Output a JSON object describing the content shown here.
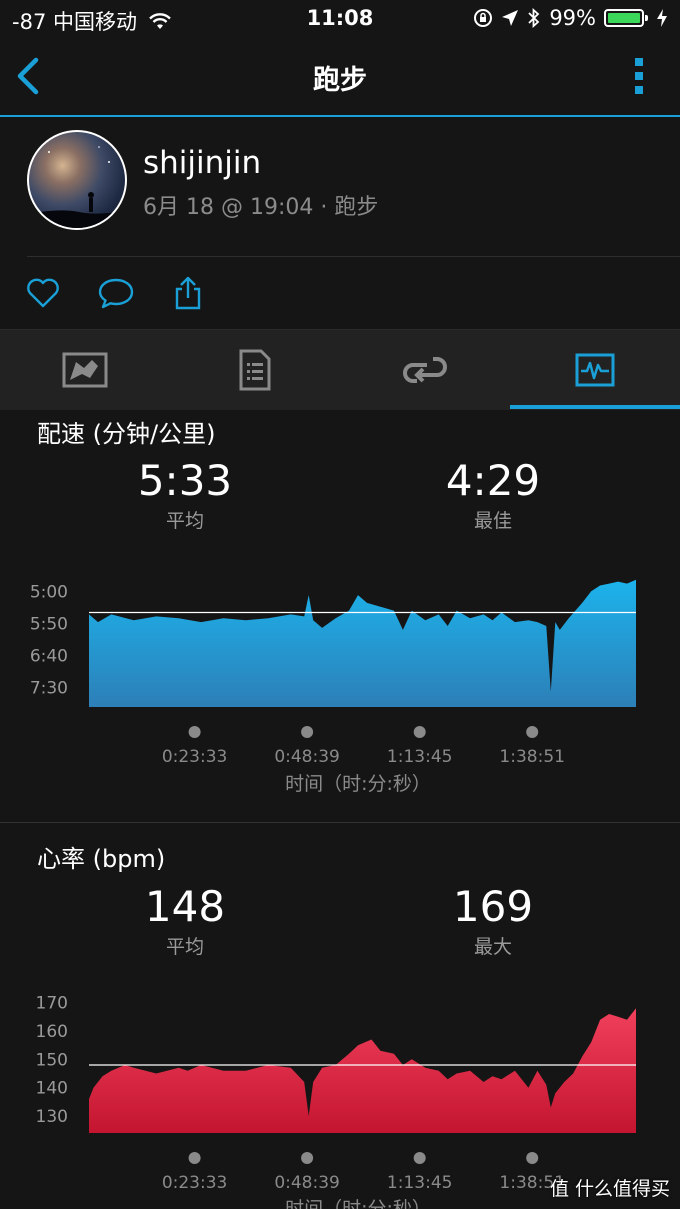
{
  "status": {
    "signal": "-87",
    "carrier": "中国移动",
    "time": "11:08",
    "battery": "99%",
    "icons": [
      "wifi-icon",
      "rotation-lock-icon",
      "location-icon",
      "bluetooth-icon",
      "battery-icon",
      "charging-icon"
    ]
  },
  "nav": {
    "title": "跑步",
    "back_icon": "chevron-left-icon",
    "more_icon": "more-vertical-icon"
  },
  "profile": {
    "username": "shijinjin",
    "meta": "6月 18 @ 19:04 · 跑步"
  },
  "actions": [
    "heart-icon",
    "comment-icon",
    "share-icon"
  ],
  "tabs": [
    {
      "name": "map-icon",
      "active": false
    },
    {
      "name": "details-icon",
      "active": false
    },
    {
      "name": "laps-icon",
      "active": false
    },
    {
      "name": "charts-icon",
      "active": true
    }
  ],
  "colors": {
    "accent": "#1aa0d6",
    "pace": "#22a8df",
    "heartrate": "#e0203f"
  },
  "pace": {
    "title": "配速 (分钟/公里)",
    "avg_value": "5:33",
    "avg_label": "平均",
    "best_value": "4:29",
    "best_label": "最佳",
    "xlabel": "时间（时:分:秒）",
    "xticks": [
      "0:23:33",
      "0:48:39",
      "1:13:45",
      "1:38:51"
    ],
    "yticks": [
      "5:00",
      "5:50",
      "6:40",
      "7:30"
    ]
  },
  "hr": {
    "title": "心率 (bpm)",
    "avg_value": "148",
    "avg_label": "平均",
    "max_value": "169",
    "max_label": "最大",
    "xlabel": "时间（时:分:秒）",
    "xticks": [
      "0:23:33",
      "0:48:39",
      "1:13:45",
      "1:38:51"
    ],
    "yticks": [
      "170",
      "160",
      "150",
      "140",
      "130"
    ]
  },
  "watermark": {
    "text": "值 什么值得买"
  },
  "chart_data": [
    {
      "type": "area",
      "title": "配速 (分钟/公里)",
      "xlabel": "时间（时:分:秒）",
      "unit": "min/km",
      "y_reversed": true,
      "xlim": [
        0,
        122
      ],
      "ylim": [
        8.0,
        4.5
      ],
      "avg_line": 5.55,
      "x": [
        0,
        2,
        5,
        10,
        15,
        20,
        25,
        30,
        35,
        40,
        45,
        48,
        49,
        50,
        52,
        55,
        58,
        60,
        62,
        65,
        68,
        70,
        72,
        75,
        78,
        80,
        82,
        85,
        88,
        90,
        92,
        95,
        98,
        100,
        102,
        103,
        104,
        105,
        107,
        110,
        112,
        114,
        116,
        118,
        120,
        122
      ],
      "values": [
        5.6,
        5.8,
        5.6,
        5.75,
        5.65,
        5.7,
        5.8,
        5.7,
        5.75,
        5.7,
        5.6,
        5.65,
        5.1,
        5.75,
        5.95,
        5.7,
        5.5,
        5.1,
        5.3,
        5.4,
        5.5,
        6.0,
        5.5,
        5.75,
        5.6,
        5.9,
        5.5,
        5.7,
        5.6,
        5.75,
        5.55,
        5.8,
        5.75,
        5.8,
        5.9,
        7.6,
        5.8,
        6.0,
        5.7,
        5.3,
        5.0,
        4.85,
        4.8,
        4.75,
        4.8,
        4.7
      ]
    },
    {
      "type": "area",
      "title": "心率 (bpm)",
      "xlabel": "时间（时:分:秒）",
      "unit": "bpm",
      "xlim": [
        0,
        122
      ],
      "ylim": [
        124,
        172
      ],
      "avg_line": 148,
      "x": [
        0,
        1,
        3,
        5,
        8,
        10,
        15,
        20,
        22,
        25,
        30,
        35,
        40,
        45,
        48,
        49,
        50,
        52,
        55,
        58,
        60,
        63,
        65,
        68,
        70,
        72,
        75,
        78,
        80,
        82,
        85,
        88,
        90,
        92,
        95,
        98,
        100,
        102,
        103,
        104,
        106,
        108,
        110,
        112,
        114,
        116,
        118,
        120,
        122
      ],
      "values": [
        136,
        140,
        144,
        146,
        148,
        147,
        145,
        147,
        146,
        148,
        146,
        146,
        148,
        147,
        142,
        130,
        142,
        147,
        148,
        152,
        155,
        157,
        153,
        152,
        148,
        150,
        147,
        146,
        143,
        145,
        146,
        142,
        144,
        143,
        146,
        140,
        146,
        141,
        133,
        138,
        142,
        145,
        151,
        156,
        164,
        166,
        165,
        164,
        168
      ]
    }
  ]
}
